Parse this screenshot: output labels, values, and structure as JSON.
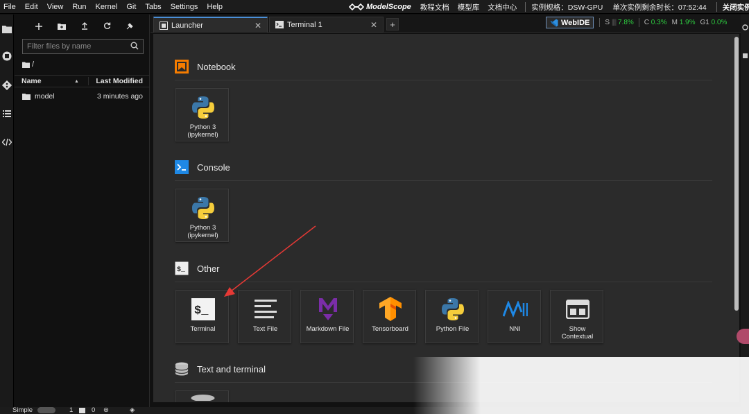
{
  "menubar": {
    "items": [
      "File",
      "Edit",
      "View",
      "Run",
      "Kernel",
      "Git",
      "Tabs",
      "Settings",
      "Help"
    ],
    "brand": "ModelScope",
    "links": [
      "教程文档",
      "模型库",
      "文档中心"
    ],
    "instance_spec": "实例规格：DSW-GPU",
    "remaining_time": "单次实例剩余时长：07:52:44",
    "close_instance": "关闭实例"
  },
  "filebrowser": {
    "filter_placeholder": "Filter files by name",
    "path": "/",
    "col_name": "Name",
    "col_modified": "Last Modified",
    "files": [
      {
        "name": "model",
        "modified": "3 minutes ago",
        "icon": "folder-icon"
      }
    ]
  },
  "tabs": [
    {
      "label": "Launcher",
      "icon": "launcher-icon",
      "active": true
    },
    {
      "label": "Terminal 1",
      "icon": "terminal-icon",
      "active": false
    }
  ],
  "status_top": {
    "webide": "WebIDE",
    "s_label": "S",
    "s_value": "7.8%",
    "c_label": "C",
    "c_value": "0.3%",
    "m_label": "M",
    "m_value": "1.9%",
    "g_label": "G1",
    "g_value": "0.0%"
  },
  "launcher": {
    "sections": [
      {
        "title": "Notebook",
        "icon": "notebook-icon"
      },
      {
        "title": "Console",
        "icon": "console-icon"
      },
      {
        "title": "Other",
        "icon": "other-icon"
      },
      {
        "title": "Text and terminal",
        "icon": "database-icon"
      }
    ],
    "notebook_cards": [
      {
        "label1": "Python 3",
        "label2": "(ipykernel)",
        "icon": "python-icon"
      }
    ],
    "console_cards": [
      {
        "label1": "Python 3",
        "label2": "(ipykernel)",
        "icon": "python-icon"
      }
    ],
    "other_cards": [
      {
        "label1": "Terminal",
        "label2": "",
        "icon": "terminal-icon"
      },
      {
        "label1": "Text File",
        "label2": "",
        "icon": "text-file-icon"
      },
      {
        "label1": "Markdown File",
        "label2": "",
        "icon": "markdown-icon"
      },
      {
        "label1": "Tensorboard",
        "label2": "",
        "icon": "tensorflow-icon"
      },
      {
        "label1": "Python File",
        "label2": "",
        "icon": "python-icon"
      },
      {
        "label1": "NNI",
        "label2": "",
        "icon": "nni-icon"
      },
      {
        "label1": "Show",
        "label2": "Contextual",
        "icon": "contextual-help-icon"
      }
    ]
  },
  "statusbar": {
    "mode": "Simple",
    "count1": "1",
    "count2": "0"
  },
  "colors": {
    "accent_blue": "#4a8fd8",
    "metric_green": "#2ecc40",
    "notebook_orange": "#f57c00",
    "console_blue": "#1e88e5",
    "arrow_red": "#e53935"
  }
}
